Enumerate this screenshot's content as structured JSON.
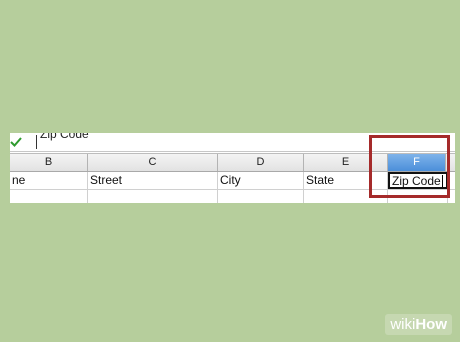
{
  "formula_bar": {
    "value": "Zip Code"
  },
  "columns": [
    {
      "label": "B",
      "selected": false
    },
    {
      "label": "C",
      "selected": false
    },
    {
      "label": "D",
      "selected": false
    },
    {
      "label": "E",
      "selected": false
    },
    {
      "label": "F",
      "selected": true
    }
  ],
  "row1": [
    "ne",
    "Street",
    "City",
    "State",
    "Zip Code"
  ],
  "colors": {
    "background": "#b6ce9c",
    "selected_header": "#4b8fda",
    "highlight": "#a52a2a"
  },
  "icons": {
    "accept": "check-icon"
  },
  "watermark": {
    "part1": "wiki",
    "part2": "How"
  }
}
